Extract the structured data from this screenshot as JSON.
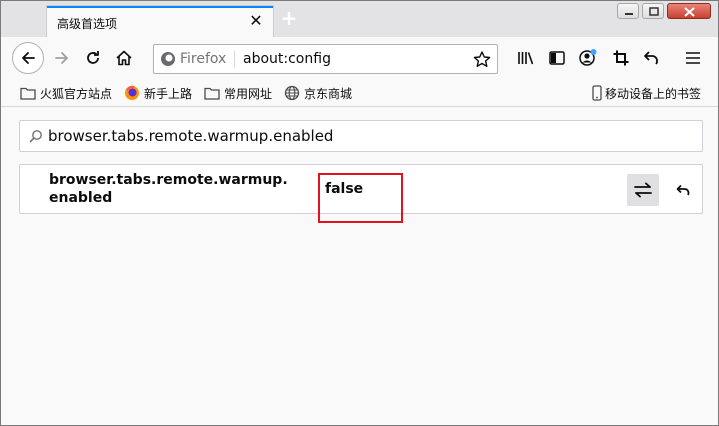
{
  "tab": {
    "title": "高级首选项",
    "close_glyph": "✕",
    "newtab_glyph": "+"
  },
  "navbar": {
    "identity_label": "Firefox",
    "url": "about:config"
  },
  "bookmarks": {
    "items": [
      {
        "label": "火狐官方站点",
        "icon": "folder-icon"
      },
      {
        "label": "新手上路",
        "icon": "firefox-logo-icon"
      },
      {
        "label": "常用网址",
        "icon": "folder-icon"
      },
      {
        "label": "京东商城",
        "icon": "globe-icon"
      }
    ],
    "mobile_label": "移动设备上的书签"
  },
  "search": {
    "value": "browser.tabs.remote.warmup.enabled"
  },
  "pref": {
    "name": "browser.tabs.remote.warmup.\nenabled",
    "value": "false"
  },
  "colors": {
    "accent": "#0a84ff",
    "highlight": "#e0141e",
    "sync_badge": "#45a1ff"
  }
}
